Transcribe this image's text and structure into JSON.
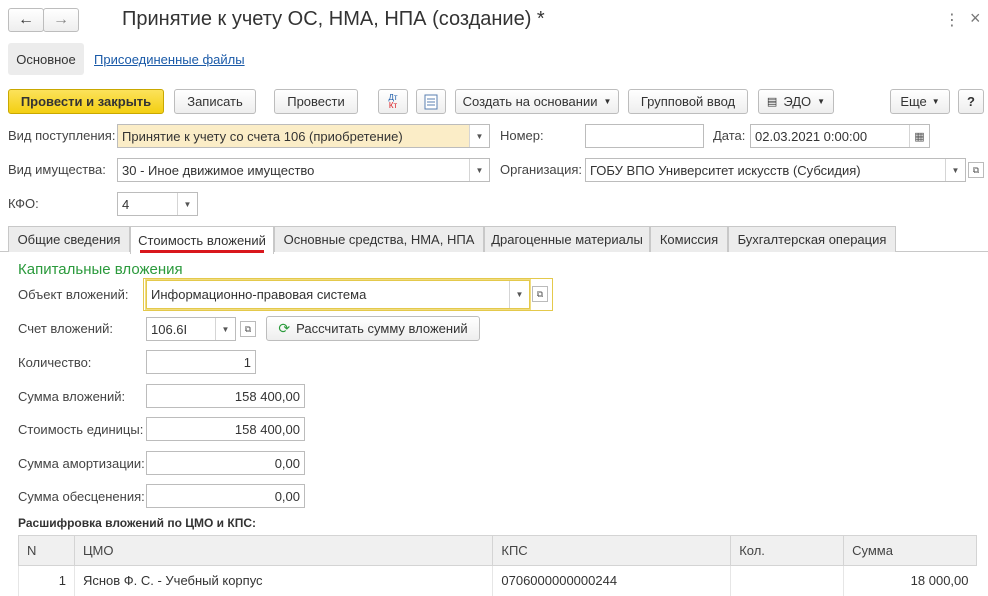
{
  "window": {
    "title": "Принятие к учету ОС, НМА, НПА (создание) *",
    "back": "←",
    "forward": "→",
    "menu": "⋮",
    "close": "×"
  },
  "form_tabs": [
    "Основное",
    "Присоединенные файлы"
  ],
  "toolbar": {
    "post_close": "Провести и закрыть",
    "save": "Записать",
    "post": "Провести",
    "create_based": "Создать на основании",
    "group_input": "Групповой ввод",
    "edo": "ЭДО",
    "more": "Еще",
    "help": "?",
    "dtkt_dt": "Дт",
    "dtkt_kt": "Кт"
  },
  "header": {
    "receipt_type_label": "Вид поступления:",
    "receipt_type_value": "Принятие к учету со счета 106 (приобретение)",
    "asset_type_label": "Вид имущества:",
    "asset_type_value": "30 - Иное движимое имущество",
    "kfo_label": "КФО:",
    "kfo_value": "4",
    "number_label": "Номер:",
    "number_value": "",
    "date_label": "Дата:",
    "date_value": "02.03.2021  0:00:00",
    "org_label": "Организация:",
    "org_value": "ГОБУ ВПО Университет искусств (Субсидия)"
  },
  "tabs": [
    "Общие сведения",
    "Стоимость вложений",
    "Основные средства, НМА, НПА",
    "Драгоценные материалы",
    "Комиссия",
    "Бухгалтерская операция"
  ],
  "active_tab": "Стоимость вложений",
  "capital": {
    "section_title": "Капитальные вложения",
    "object_label": "Объект вложений:",
    "object_value": "Информационно-правовая система",
    "account_label": "Счет вложений:",
    "account_value": "106.6I",
    "recalc_button": "Рассчитать сумму вложений",
    "quantity_label": "Количество:",
    "quantity_value": "1",
    "sum_label": "Сумма вложений:",
    "sum_value": "158 400,00",
    "unit_cost_label": "Стоимость единицы:",
    "unit_cost_value": "158 400,00",
    "amort_label": "Сумма амортизации:",
    "amort_value": "0,00",
    "impair_label": "Сумма обесценения:",
    "impair_value": "0,00",
    "breakdown_title": "Расшифровка вложений по ЦМО и КПС:"
  },
  "table": {
    "columns": [
      "N",
      "ЦМО",
      "КПС",
      "Кол.",
      "Сумма"
    ],
    "rows": [
      {
        "n": "1",
        "cmo": "Яснов Ф. С. - Учебный корпус",
        "kps": "0706000000000244",
        "qty": "",
        "sum": "18 000,00"
      }
    ]
  },
  "colors": {
    "primary_button": "#f3cf12",
    "section_title": "#2b9a3c",
    "link": "#1a5aa8",
    "active_tab_underline": "#d9171d",
    "mandatory_field": "#fbedc7"
  }
}
